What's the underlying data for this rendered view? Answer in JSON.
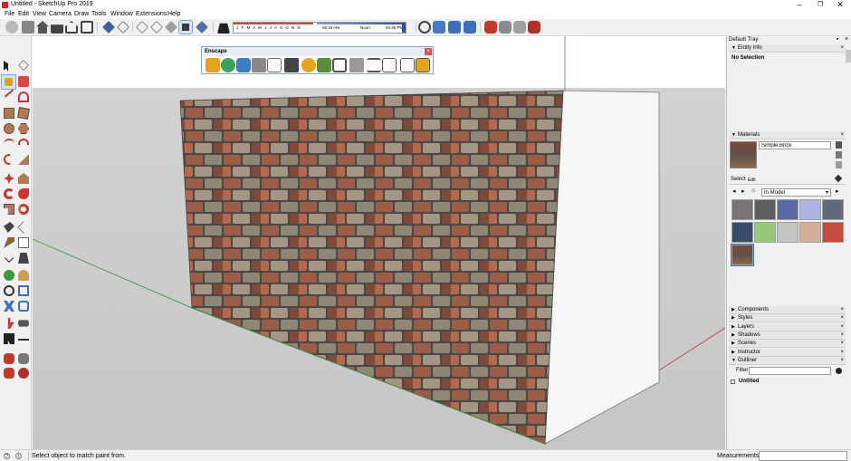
{
  "window": {
    "title": "Untitled - SketchUp Pro 2019",
    "buttons": {
      "minimize": "–",
      "maximize": "❐",
      "close": "✕"
    }
  },
  "menu": [
    "File",
    "Edit",
    "View",
    "Camera",
    "Draw",
    "Tools",
    "Window",
    "Extensions",
    "Help"
  ],
  "shadows": {
    "months": "J  F  M  A  M  J  J  A  S  O  N  D",
    "time_start": "06:43 AM",
    "noon": "Noon",
    "time_end": "04:46 PM"
  },
  "enscape": {
    "title": "Enscape",
    "close": "×"
  },
  "tray": {
    "title": "Default Tray",
    "pin": "▪",
    "close": "×",
    "entity_info": "Entity Info",
    "no_selection": "No Selection",
    "materials": "Materials",
    "material_name": "Simple Brick",
    "tabs": [
      "Select",
      "Edit"
    ],
    "library": "In Model",
    "panels": [
      "Components",
      "Styles",
      "Layers",
      "Shadows",
      "Scenes",
      "Instructor",
      "Outliner"
    ],
    "filter_label": "Filter:",
    "outliner_root": "Untitled",
    "swatch_colors": [
      "#7a7575",
      "#5f5e5e",
      "#5b68a6",
      "#a9b5e0",
      "#63687b",
      "#394a6b",
      "#93c979",
      "#c4c4c4",
      "#d4ad9b",
      "#c24f3d",
      "#7a5a4a"
    ],
    "colors": {
      "header": "#e6e6e6",
      "panel_bg": "#f0f0f0"
    }
  },
  "status": {
    "message": "Select object to match paint from.",
    "measurements_label": "Measurements"
  },
  "colors": {
    "sky": "#ffffff",
    "ground": "#cecece",
    "accent": "#c8262c",
    "brick_face": "#9a6d54",
    "side_face": "#f5f5f5"
  }
}
